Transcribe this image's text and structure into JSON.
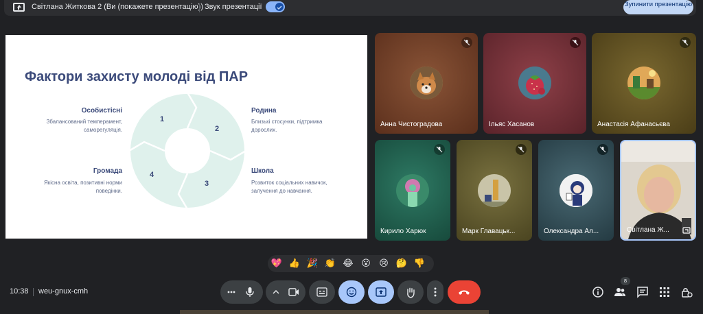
{
  "topbar": {
    "presenting_label": "Світлана Житкова 2 (Ви (покажете презентацію))",
    "sound_label": "Звук презентації",
    "stop_button_label": "Зупинити презентацію"
  },
  "slide": {
    "title": "Фактори захисту молоді від ПАР",
    "quadrants": [
      {
        "title": "Особистісні",
        "desc": "Збалансований темперамент, саморегуляція.",
        "number": "1"
      },
      {
        "title": "Родина",
        "desc": "Близькі стосунки, підтримка дорослих.",
        "number": "2"
      },
      {
        "title": "Школа",
        "desc": "Розвиток соціальних навичок, залучення до навчання.",
        "number": "3"
      },
      {
        "title": "Громада",
        "desc": "Якісна освіта, позитивні норми поведінки.",
        "number": "4"
      }
    ],
    "ring_color": "#dff1ec"
  },
  "participants": [
    {
      "name": "Анна Чистоградова",
      "muted": true,
      "avatar": "corgi-avatar",
      "bg": "#6b3a25"
    },
    {
      "name": "Ільяс Хасанов",
      "muted": true,
      "avatar": "strawberry-avatar",
      "bg": "#6e2f36"
    },
    {
      "name": "Анастасія Афанасьєва",
      "muted": true,
      "avatar": "minecraft-avatar",
      "bg": "#5a4a1e"
    },
    {
      "name": "Кирило Харюк",
      "muted": true,
      "avatar": "statue-avatar",
      "bg": "#1e5a4b"
    },
    {
      "name": "Марк Главацьк...",
      "muted": true,
      "avatar": "painting-avatar",
      "bg": "#5c5226"
    },
    {
      "name": "Олександра Ал...",
      "muted": true,
      "avatar": "anime-avatar",
      "bg": "#2f4a54"
    },
    {
      "name": "Світлана Ж...",
      "muted": false,
      "avatar": "camera-feed",
      "bg": "#d8d2c8"
    }
  ],
  "reactions": [
    "💖",
    "👍",
    "🎉",
    "👏",
    "😂",
    "😮",
    "😢",
    "🤔",
    "👎"
  ],
  "bottombar": {
    "time": "10:38",
    "meeting_code": "weu-gnux-cmh",
    "people_count": "8"
  },
  "colors": {
    "accent": "#a8c7fa",
    "hangup": "#ea4335",
    "background": "#202124"
  }
}
